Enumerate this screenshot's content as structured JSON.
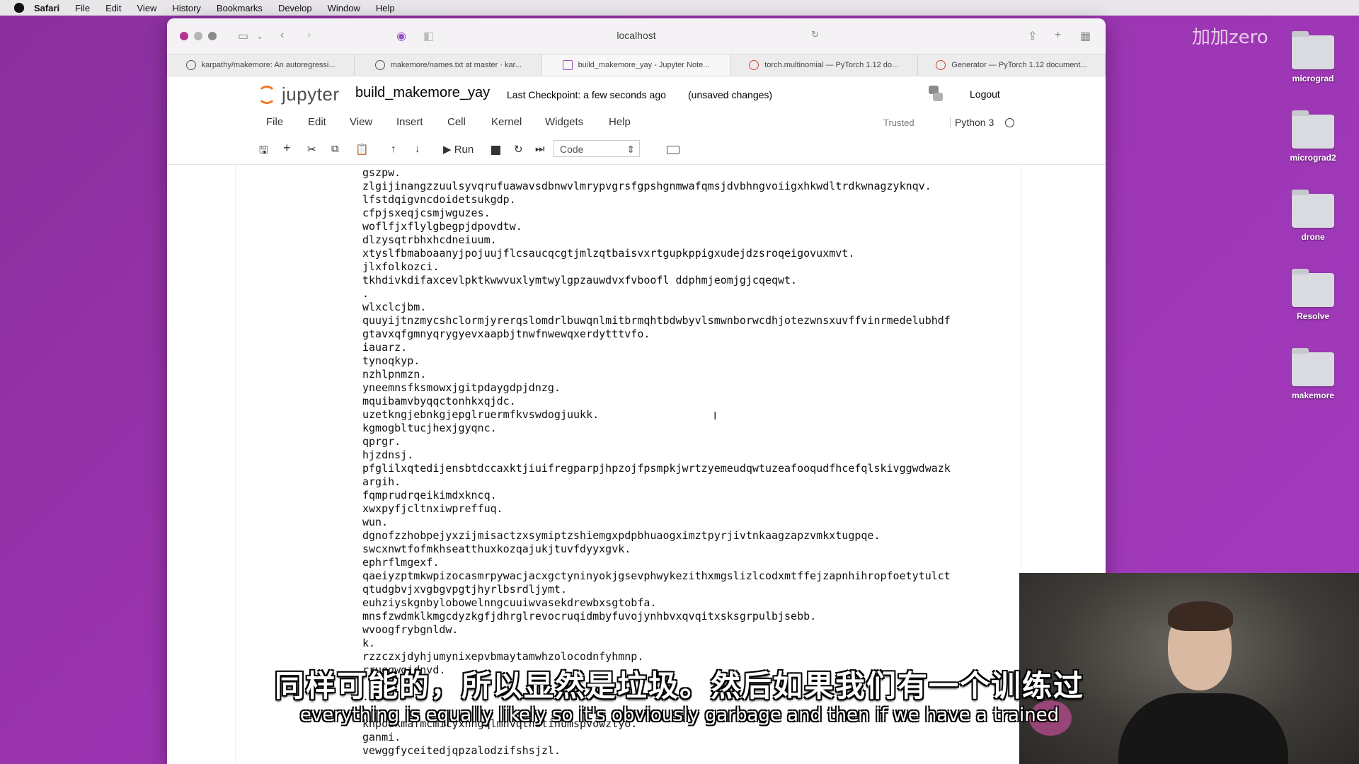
{
  "menubar": {
    "items": [
      "Safari",
      "File",
      "Edit",
      "View",
      "History",
      "Bookmarks",
      "Develop",
      "Window",
      "Help"
    ]
  },
  "desktop": {
    "watermark": "加加zero",
    "folders": [
      "micrograd",
      "micrograd2",
      "drone",
      "Resolve",
      "makemore"
    ]
  },
  "browser": {
    "address": "localhost",
    "tabs": [
      "karpathy/makemore: An autoregressi...",
      "makemore/names.txt at master · kar...",
      "build_makemore_yay - Jupyter Note...",
      "torch.multinomial — PyTorch 1.12 do...",
      "Generator — PyTorch 1.12 document..."
    ]
  },
  "jupyter": {
    "logo_text": "jupyter",
    "notebook_title": "build_makemore_yay",
    "checkpoint": "Last Checkpoint: a few seconds ago",
    "status": "(unsaved changes)",
    "logout": "Logout",
    "menu": [
      "File",
      "Edit",
      "View",
      "Insert",
      "Cell",
      "Kernel",
      "Widgets",
      "Help"
    ],
    "trusted": "Trusted",
    "kernel": "Python 3",
    "run_label": "Run",
    "cell_type": "Code"
  },
  "output_lines": [
    "gszpw.",
    "zlgijinangzzuulsyvqrufuawavsdbnwvlmrypvgrsfgpshgnmwafqmsjdvbhngvoiigxhkwdltrdkwnagzyknqv.",
    "lfstdqigvncdoidetsukgdp.",
    "cfpjsxeqjcsmjwguzes.",
    "woflfjxflylgbegpjdpovdtw.",
    "dlzysqtrbhxhcdneiuum.",
    "xtyslfbmaboaanyjpojuujflcsaucqcgtjmlzqtbaisvxrtgupkppigxudejdzsroqeigovuxmvt.",
    "jlxfolkozci.",
    "tkhdivkdifaxcevlpktkwwvuxlymtwylgpzauwdvxfvboofl ddphmjeomjgjcqeqwt.",
    ".",
    "wlxclcjbm.",
    "quuyijtnzmycshclormjyrerqslomdrlbuwqnlmitbrmqhtbdwbyvlsmwnborwcdhjotezwnsxuvffvinrmedelubhdf",
    "gtavxqfgmnyqrygyevxaapbjtnwfnwewqxerdytttvfo.",
    "iauarz.",
    "tynoqkyp.",
    "nzhlpnmzn.",
    "yneemnsfksmowxjgitpdaygdpjdnzg.",
    "mquibamvbyqqctonhkxqjdc.",
    "uzetkngjebnkgjepglruermfkvswdogjuukk.",
    "kgmogbltucjhexjgyqnc.",
    "qprgr.",
    "hjzdnsj.",
    "pfglilxqtedijensbtdccaxktjiuifregparpjhpzojfpsmpkjwrtzyemeudqwtuzeafooqudfhcefqlskivggwdwazk",
    "argih.",
    "fqmprudrqeikimdxkncq.",
    "xwxpyfjcltnxiwpreffuq.",
    "wun.",
    "dgnofzzhobpejyxzijmisactzxsymiptzshiemgxpdpbhuaogximztpyrjivtnkaagzapzvmkxtugpqe.",
    "swcxnwtfofmkhseatthuxkozqajukjtuvfdyyxgvk.",
    "ephrflmgexf.",
    "qaeiyzptmkwpizocasmrpywacjacxgctyninyokjgsevphwykezithxmgslizlcodxmtffejzapnhihropfoetytulct",
    "qtudgbvjxvgbgvpgtjhyrlbsrdljymt.",
    "euhziyskgnbylobowelnngcuuiwvasekdrewbxsgtobfa.",
    "mnsfzwdmklkmgcdyzkgfjdhrglrevocruqidmbyfuvojynhbvxqvqitxsksgrpulbjsebb.",
    "wvoogfrybgnldw.",
    "k.",
    "rzzczxjdyhjumynixepvbmaytamwhzolocodnfyhmnp.",
    "rruggwgjdnvd.",
    "",
    ".",
    "",
    "khpoukmafmcmicyxhngqlmhvqthstinumspvowztyo.",
    "ganmi.",
    "vewggfyceitedjqpzalodzifshsjzl."
  ],
  "subtitles": {
    "zh": "同样可能的，所以显然是垃圾。然后如果我们有一个训练过",
    "en": "everything is equally likely so it's obviously garbage and then if we have a trained"
  }
}
